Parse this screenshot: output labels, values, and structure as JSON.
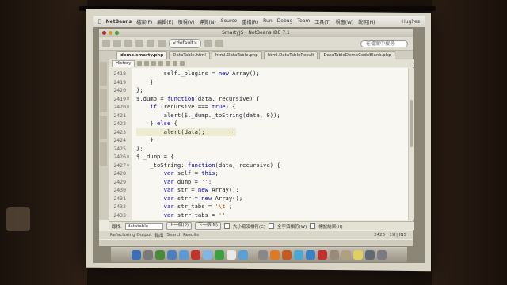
{
  "menubar": {
    "brand": "NetBeans",
    "items": [
      "檔案(F)",
      "編輯(E)",
      "檢視(V)",
      "導覽(N)",
      "Source",
      "重構(R)",
      "Run",
      "Debug",
      "Team",
      "工具(T)",
      "視窗(W)",
      "說明(H)"
    ],
    "right": "Hughes"
  },
  "window": {
    "title": "SmartyJS - NetBeans IDE 7.1"
  },
  "toolbar": {
    "config": "<default>",
    "search_placeholder": "在檔案中搜尋"
  },
  "tabs": [
    {
      "label": "demo.smarty.php",
      "active": true
    },
    {
      "label": "DataTable.html",
      "active": false
    },
    {
      "label": "html.DataTable.php",
      "active": false
    },
    {
      "label": "html.DataTableResult",
      "active": false
    },
    {
      "label": "DataTableDemoCodeBlank.php",
      "active": false
    }
  ],
  "editor_toolbar": {
    "source_label": "History"
  },
  "code_lines": [
    {
      "num": "2418",
      "fold": "",
      "html": "        self._plugins = <span class='kw'>new</span> Array();"
    },
    {
      "num": "2419",
      "fold": "",
      "html": "    }"
    },
    {
      "num": "2420",
      "fold": "",
      "html": "};"
    },
    {
      "num": "2419",
      "fold": "⊟",
      "html": "$.dump = <span class='kw'>function</span>(data, recursive) {"
    },
    {
      "num": "2420",
      "fold": "⊟",
      "html": "    <span class='kw'>if</span> (recursive === <span class='kw'>true</span>) {"
    },
    {
      "num": "2421",
      "fold": "",
      "html": "        alert($._dump._toString(data, 0));"
    },
    {
      "num": "2422",
      "fold": "",
      "html": "    } <span class='kw'>else</span> {"
    },
    {
      "num": "2423",
      "fold": "",
      "html": "        alert(data);        |"
    },
    {
      "num": "2424",
      "fold": "",
      "html": "    }"
    },
    {
      "num": "2425",
      "fold": "",
      "html": "};"
    },
    {
      "num": "2426",
      "fold": "⊟",
      "html": "$._dump = {"
    },
    {
      "num": "2427",
      "fold": "⊟",
      "html": "    _toString: <span class='kw'>function</span>(data, recursive) {"
    },
    {
      "num": "2428",
      "fold": "",
      "html": "        <span class='kw'>var</span> self = <span class='kw'>this</span>;"
    },
    {
      "num": "2429",
      "fold": "",
      "html": "        <span class='kw'>var</span> dump = <span class='str'>''</span>;"
    },
    {
      "num": "2430",
      "fold": "",
      "html": "        <span class='kw'>var</span> str = <span class='kw'>new</span> Array();"
    },
    {
      "num": "2431",
      "fold": "",
      "html": "        <span class='kw'>var</span> strr = <span class='kw'>new</span> Array();"
    },
    {
      "num": "2432",
      "fold": "",
      "html": "        <span class='kw'>var</span> str_tabs = <span class='str'>'\\t'</span>;"
    },
    {
      "num": "2433",
      "fold": "",
      "html": "        <span class='kw'>var</span> strr_tabs = <span class='str'>''</span>;"
    }
  ],
  "caret_line_index": 7,
  "findbar": {
    "label": "尋找:",
    "value": "datatable",
    "prev": "上一個(P)",
    "next": "下一個(N)",
    "opt1": "大小寫須相符(C)",
    "opt2": "全字須相符(W)",
    "opt3": "標記結果(H)"
  },
  "status": {
    "left": "Refactoring Output",
    "mid": "輸出",
    "right2": "Search Results",
    "position": "2423 | 19 | INS"
  },
  "dock_colors": [
    "#3b6fb5",
    "#7a7a7a",
    "#4a8a3a",
    "#4a7fc2",
    "#5c9ad6",
    "#c2352c",
    "#7eb6e6",
    "#3aa040",
    "#e8e8e8",
    "#5aa0d8",
    "#888",
    "#e07a20",
    "#c25a22",
    "#4aa8d8",
    "#3a82c4",
    "#c23030",
    "#9a8a7a",
    "#b0a080",
    "#e0d060",
    "#606a70",
    "#7a7a80"
  ]
}
